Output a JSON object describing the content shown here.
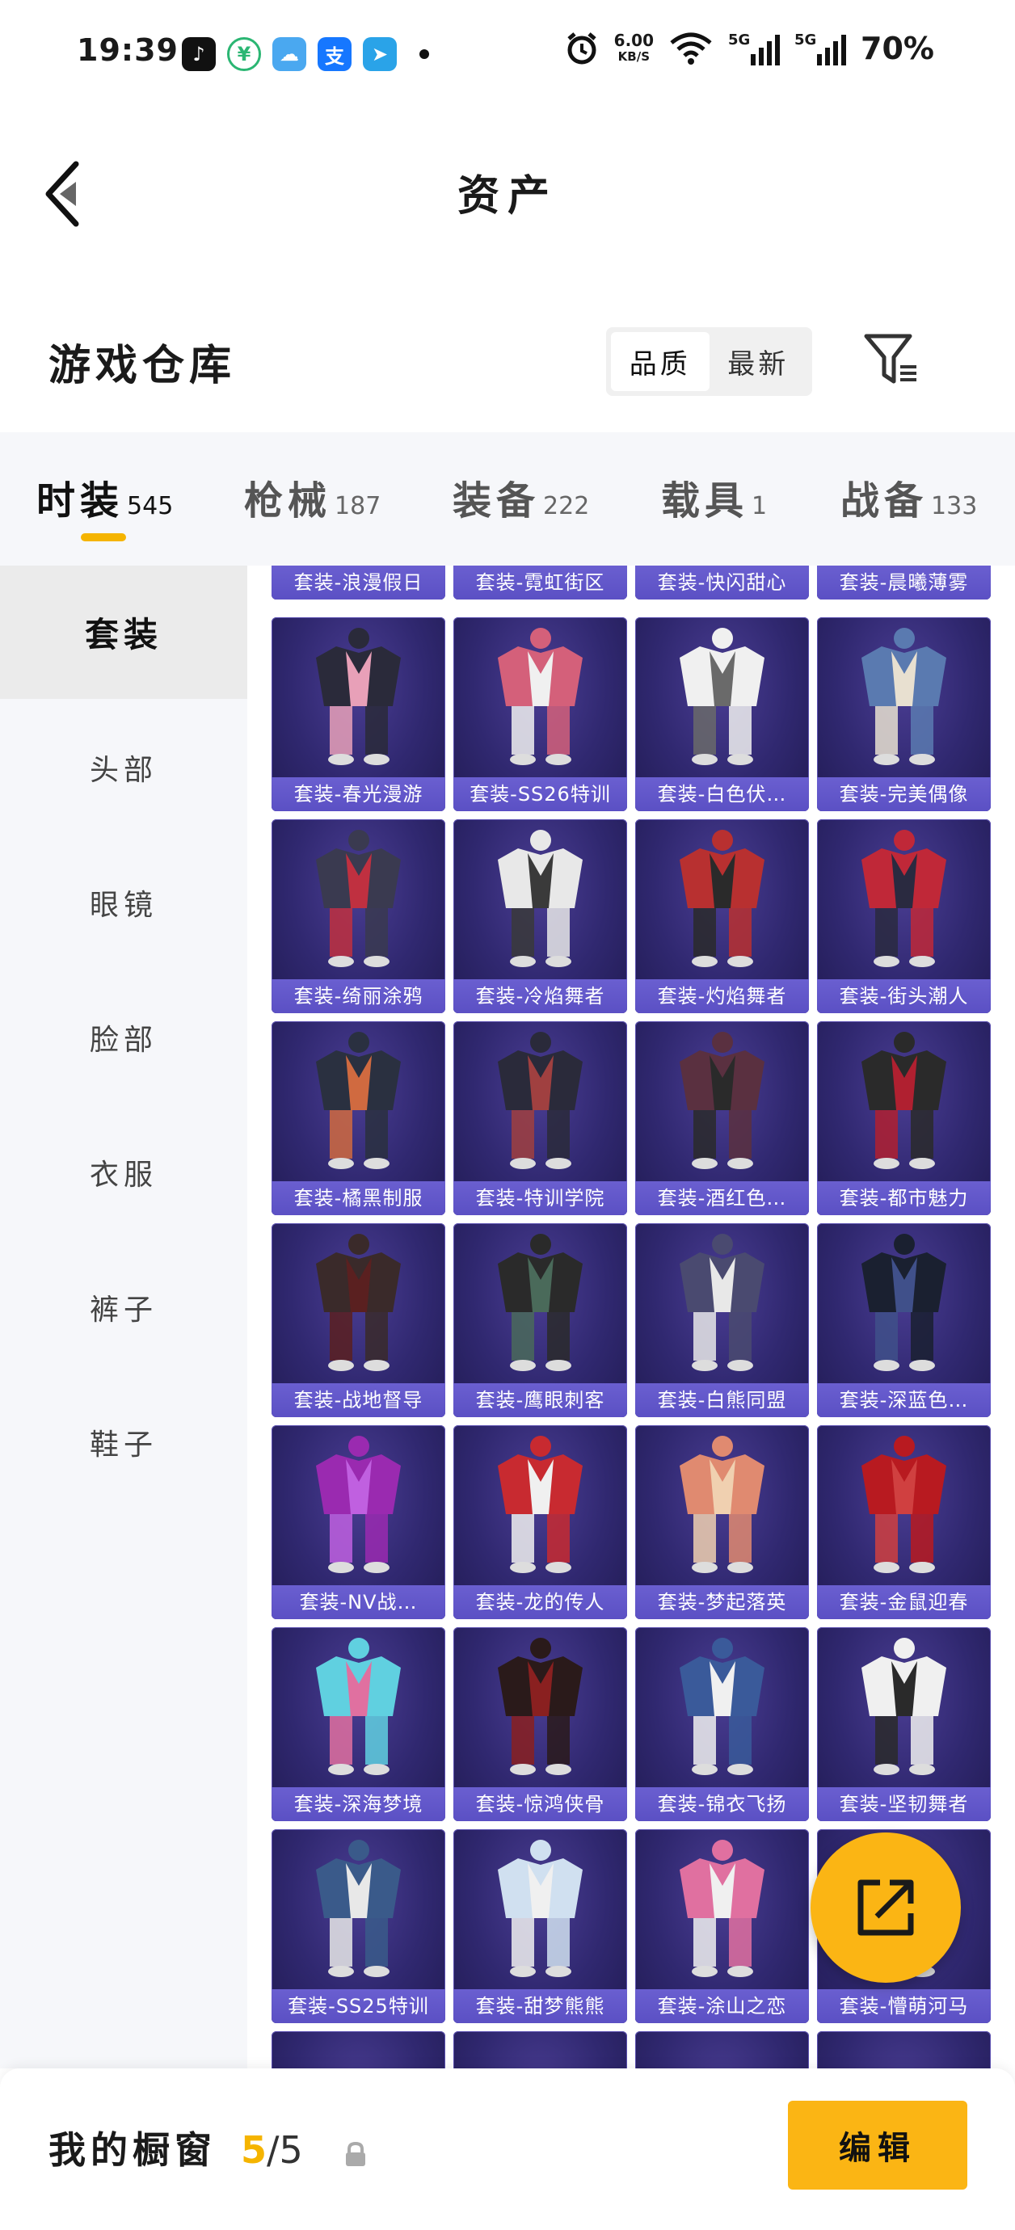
{
  "status_bar": {
    "time": "19:39",
    "net_speed": "6.00",
    "net_unit": "KB/S",
    "battery": "70%",
    "sig1": "5G",
    "sig2": "5G",
    "app_icons": [
      "douyin-icon",
      "bank-icon",
      "weather-icon",
      "alipay-icon",
      "telegram-icon"
    ]
  },
  "header": {
    "title": "资产"
  },
  "warehouse": {
    "title": "游戏仓库",
    "sort": [
      "品质",
      "最新"
    ],
    "active_sort": "品质"
  },
  "tabs": [
    {
      "label": "时装",
      "count": "545"
    },
    {
      "label": "枪械",
      "count": "187"
    },
    {
      "label": "装备",
      "count": "222"
    },
    {
      "label": "载具",
      "count": "1"
    },
    {
      "label": "战备",
      "count": "133"
    }
  ],
  "sidebar": [
    "套装",
    "头部",
    "眼镜",
    "脸部",
    "衣服",
    "裤子",
    "鞋子"
  ],
  "partial_row": [
    "套装-浪漫假日",
    "套装-霓虹街区",
    "套装-快闪甜心",
    "套装-晨曦薄雾"
  ],
  "items": [
    "套装-春光漫游",
    "套装-SS26特训",
    "套装-白色伏…",
    "套装-完美偶像",
    "套装-绮丽涂鸦",
    "套装-冷焰舞者",
    "套装-灼焰舞者",
    "套装-街头潮人",
    "套装-橘黑制服",
    "套装-特训学院",
    "套装-酒红色…",
    "套装-都市魅力",
    "套装-战地督导",
    "套装-鹰眼刺客",
    "套装-白熊同盟",
    "套装-深蓝色…",
    "套装-NV战…",
    "套装-龙的传人",
    "套装-梦起落英",
    "套装-金鼠迎春",
    "套装-深海梦境",
    "套装-惊鸿侠骨",
    "套装-锦衣飞扬",
    "套装-坚韧舞者",
    "套装-SS25特训",
    "套装-甜梦熊熊",
    "套装-涂山之恋",
    "套装-懵萌河马"
  ],
  "bottom": {
    "label": "我的橱窗",
    "used": "5",
    "slash": "/",
    "total": "5",
    "edit": "编辑"
  },
  "colors": {
    "accent": "#fbb514",
    "card_bg": "#302870",
    "card_caption": "#5b50c4"
  }
}
